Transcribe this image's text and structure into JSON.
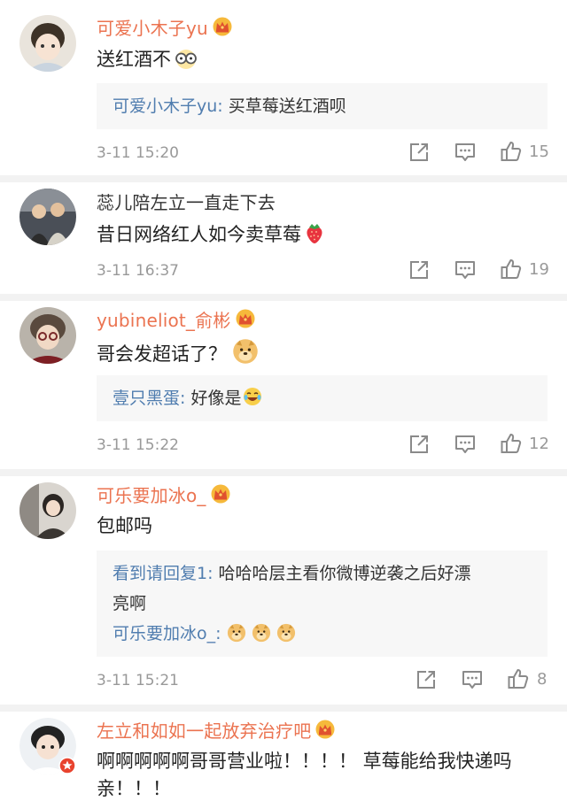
{
  "comments": [
    {
      "username": "可爱小木子yu",
      "text": "送红酒不",
      "reply": {
        "name": "可爱小木子yu:",
        "text": " 买草莓送红酒呗"
      },
      "time": "3-11 15:20",
      "likes": "15"
    },
    {
      "username": "蕊儿陪左立一直走下去",
      "text": "昔日网络红人如今卖草莓",
      "time": "3-11 16:37",
      "likes": "19"
    },
    {
      "username": "yubineliot_俞彬",
      "text": "哥会发超话了？",
      "reply": {
        "name": "壹只黑蛋:",
        "text": " 好像是"
      },
      "time": "3-11 15:22",
      "likes": "12"
    },
    {
      "username": "可乐要加冰o_",
      "text": "包邮吗",
      "reply": {
        "name": "看到请回复1:",
        "text": " 哈哈哈层主看你微博逆袭之后好漂",
        "text2": "亮啊"
      },
      "reply2": {
        "name": "可乐要加冰o_:"
      },
      "time": "3-11 15:21",
      "likes": "8"
    },
    {
      "username": "左立和如如一起放弃治疗吧",
      "text": "啊啊啊啊啊哥哥营业啦！！！！ 草莓能给我快递吗",
      "text2": "亲！！！"
    }
  ],
  "icons": {
    "vip": "crown-icon",
    "share": "share-icon",
    "comment": "comment-icon",
    "like": "thumbs-up-icon"
  },
  "colors": {
    "vip_name": "#eb7350",
    "reply_name": "#507daf",
    "meta": "#999999",
    "separator": "#f2f2f2",
    "reply_bg": "#f7f7f7"
  }
}
